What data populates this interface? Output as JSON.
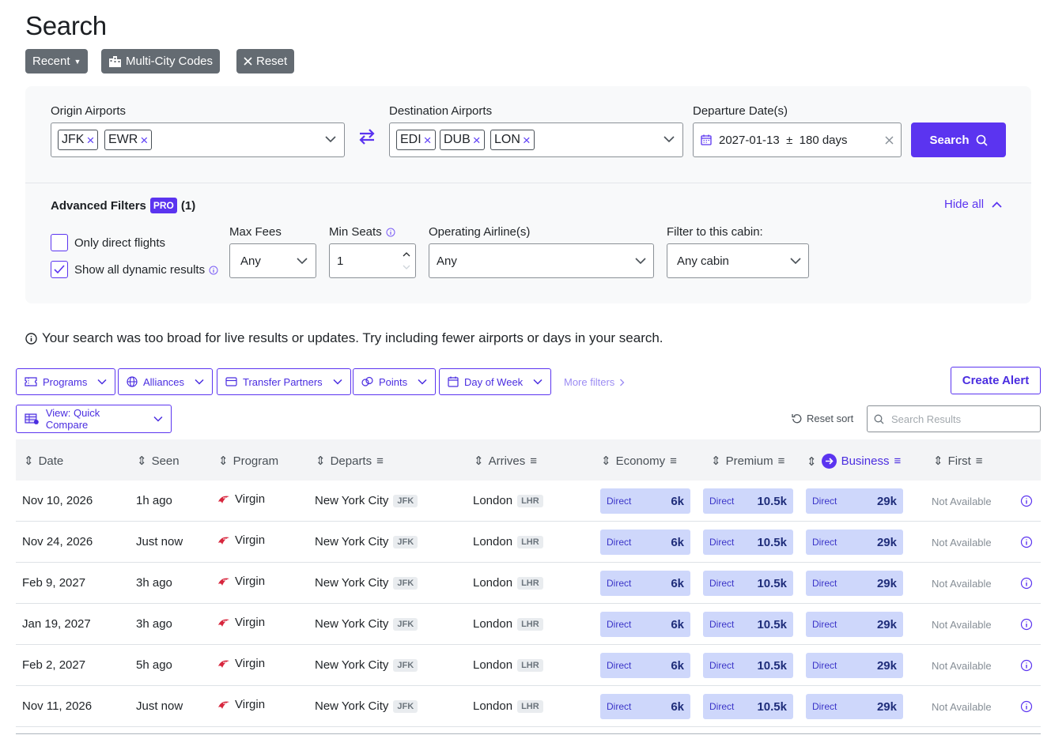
{
  "page": {
    "title": "Search"
  },
  "top_buttons": {
    "recent": "Recent",
    "multi_city": "Multi-City Codes",
    "reset": "Reset"
  },
  "search": {
    "origin_label": "Origin Airports",
    "origin_chips": [
      "JFK",
      "EWR"
    ],
    "destination_label": "Destination Airports",
    "destination_chips": [
      "EDI",
      "DUB",
      "LON"
    ],
    "date_label": "Departure Date(s)",
    "date_value": "2027-01-13  ±  180 days",
    "search_button": "Search"
  },
  "advanced": {
    "title": "Advanced Filters",
    "pro": "PRO",
    "count": "(1)",
    "hide_all": "Hide all",
    "only_direct": {
      "label": "Only direct flights",
      "checked": false
    },
    "show_dynamic": {
      "label": "Show all dynamic results",
      "checked": true
    },
    "max_fees": {
      "label": "Max Fees",
      "value": "Any"
    },
    "min_seats": {
      "label": "Min Seats",
      "value": "1"
    },
    "airlines": {
      "label": "Operating Airline(s)",
      "value": "Any"
    },
    "cabin": {
      "label": "Filter to this cabin:",
      "value": "Any cabin"
    }
  },
  "notice": "Your search was too broad for live results or updates. Try including fewer airports or days in your search.",
  "filters": {
    "programs": "Programs",
    "alliances": "Alliances",
    "transfer_partners": "Transfer Partners",
    "points": "Points",
    "day_of_week": "Day of Week",
    "more": "More filters",
    "create_alert": "Create Alert",
    "view": "View: Quick Compare",
    "reset_sort": "Reset sort",
    "search_placeholder": "Search Results"
  },
  "table": {
    "columns": [
      "Date",
      "Seen",
      "Program",
      "Departs",
      "Arrives",
      "Economy",
      "Premium",
      "Business",
      "First"
    ],
    "rows": [
      {
        "date": "Nov 10, 2026",
        "seen": "1h ago",
        "program": "Virgin",
        "departs": "New York City",
        "dep_code": "JFK",
        "arrives": "London",
        "arr_code": "LHR",
        "economy": "6k",
        "premium": "10.5k",
        "business": "29k",
        "first": "Not Available",
        "tag": "Direct"
      },
      {
        "date": "Nov 24, 2026",
        "seen": "Just now",
        "program": "Virgin",
        "departs": "New York City",
        "dep_code": "JFK",
        "arrives": "London",
        "arr_code": "LHR",
        "economy": "6k",
        "premium": "10.5k",
        "business": "29k",
        "first": "Not Available",
        "tag": "Direct"
      },
      {
        "date": "Feb 9, 2027",
        "seen": "3h ago",
        "program": "Virgin",
        "departs": "New York City",
        "dep_code": "JFK",
        "arrives": "London",
        "arr_code": "LHR",
        "economy": "6k",
        "premium": "10.5k",
        "business": "29k",
        "first": "Not Available",
        "tag": "Direct"
      },
      {
        "date": "Jan 19, 2027",
        "seen": "3h ago",
        "program": "Virgin",
        "departs": "New York City",
        "dep_code": "JFK",
        "arrives": "London",
        "arr_code": "LHR",
        "economy": "6k",
        "premium": "10.5k",
        "business": "29k",
        "first": "Not Available",
        "tag": "Direct"
      },
      {
        "date": "Feb 2, 2027",
        "seen": "5h ago",
        "program": "Virgin",
        "departs": "New York City",
        "dep_code": "JFK",
        "arrives": "London",
        "arr_code": "LHR",
        "economy": "6k",
        "premium": "10.5k",
        "business": "29k",
        "first": "Not Available",
        "tag": "Direct"
      },
      {
        "date": "Nov 11, 2026",
        "seen": "Just now",
        "program": "Virgin",
        "departs": "New York City",
        "dep_code": "JFK",
        "arrives": "London",
        "arr_code": "LHR",
        "economy": "6k",
        "premium": "10.5k",
        "business": "29k",
        "first": "Not Available",
        "tag": "Direct"
      }
    ]
  },
  "colors": {
    "accent": "#5b34f0",
    "price_bg": "#ced7fb",
    "button_gray": "#646b72"
  }
}
